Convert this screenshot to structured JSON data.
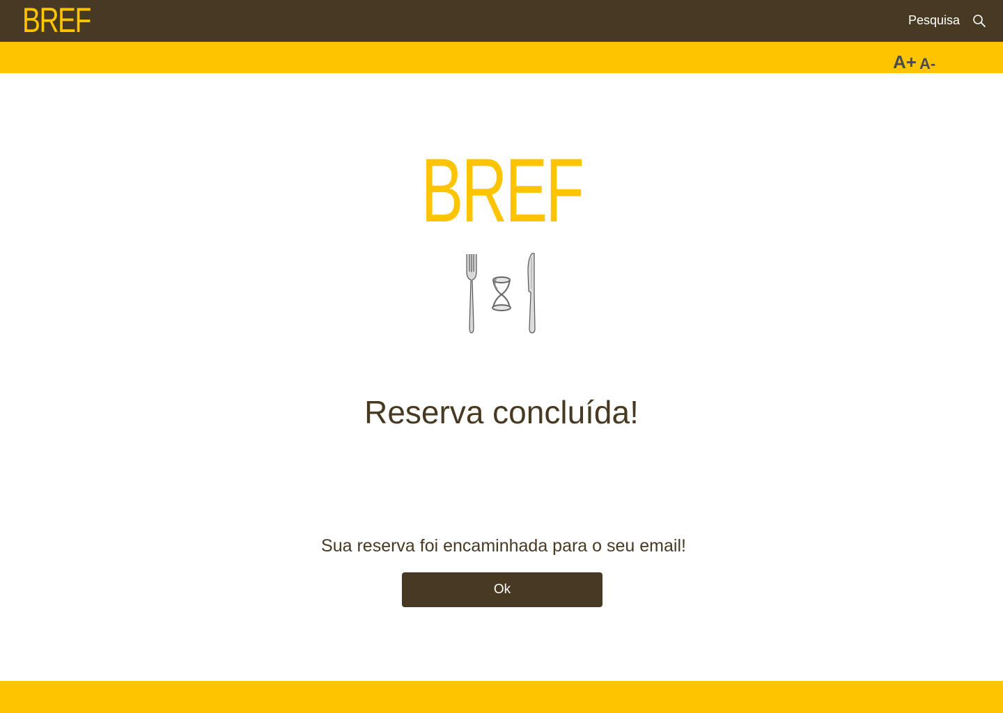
{
  "header": {
    "logo": "BREF",
    "search_label": "Pesquisa",
    "search_icon": "search-icon"
  },
  "accessibility": {
    "increase_font": "A+",
    "decrease_font": "A-"
  },
  "main": {
    "logo": "BREF",
    "illustration_icon": "fork-hourglass-knife-icon",
    "title": "Reserva concluída!",
    "message": "Sua reserva foi encaminhada para o seu email!",
    "ok_label": "Ok"
  },
  "colors": {
    "brand_dark": "#483a22",
    "brand_accent": "#ffc400",
    "background": "#ffffff"
  }
}
